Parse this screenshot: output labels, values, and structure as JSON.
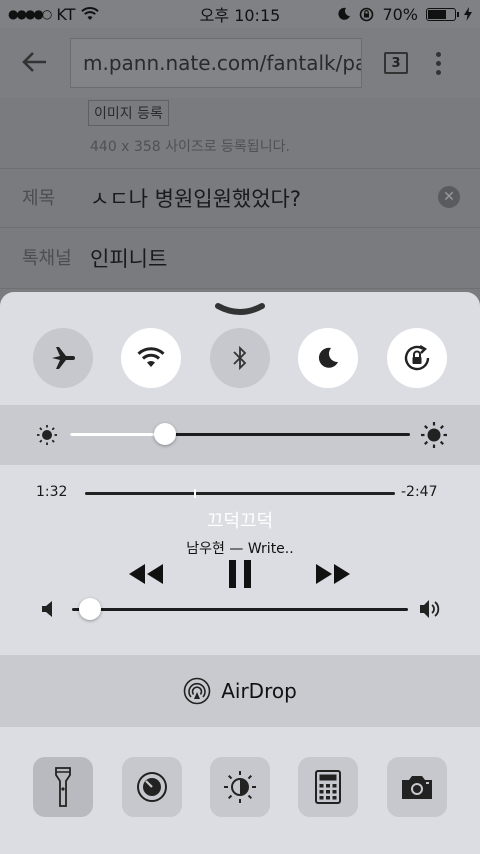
{
  "status_bar": {
    "carrier": "KT",
    "signal_dots": "●●●●○",
    "time": "오후 10:15",
    "battery_percent": "70%",
    "battery_level": 0.7
  },
  "browser": {
    "url": "m.pann.nate.com/fantalk/pann",
    "tab_count": "3"
  },
  "page": {
    "image_button": "이미지 등록",
    "image_note": "440 x 358 사이즈로 등록됩니다.",
    "title_label": "제목",
    "title_value": "ㅅㄷ나 병원입원했었다?",
    "channel_label": "톡채널",
    "channel_value": "인피니트"
  },
  "control_center": {
    "toggles": [
      {
        "name": "airplane-mode",
        "icon": "airplane-icon",
        "on": false
      },
      {
        "name": "wifi",
        "icon": "wifi-icon",
        "on": true
      },
      {
        "name": "bluetooth",
        "icon": "bluetooth-icon",
        "on": false
      },
      {
        "name": "do-not-disturb",
        "icon": "moon-icon",
        "on": true
      },
      {
        "name": "rotation-lock",
        "icon": "rotation-lock-icon",
        "on": true
      }
    ],
    "brightness_level": 0.28,
    "music": {
      "elapsed": "1:32",
      "remaining": "-2:47",
      "progress": 0.35,
      "song": "끄덕끄덕",
      "artist": "남우현 — Write.."
    },
    "volume_level": 0.02,
    "airdrop_label": "AirDrop",
    "shortcuts": [
      "flashlight-icon",
      "timer-icon",
      "night-shift-icon",
      "calculator-icon",
      "camera-icon"
    ]
  }
}
